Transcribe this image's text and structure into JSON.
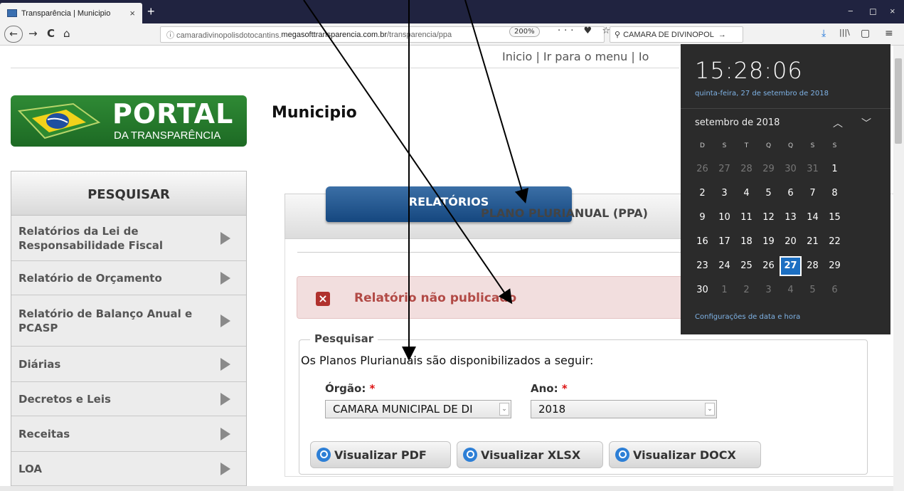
{
  "browser": {
    "tab_title": "Transparência | Municipio",
    "tab_close": "×",
    "new_tab": "+",
    "window_controls": [
      "−",
      "◻",
      "×"
    ],
    "url_prefix": "ⓘ camaradivinopolisdotocantins.",
    "url_host": "megasofttransparencia.com.br",
    "url_path": "/transparencia/ppa",
    "zoom": "200%",
    "url_icons": "··· ♥ ☆",
    "search_text": "CAMARA DE DIVINOPOL",
    "nav": {
      "back": "←",
      "forward": "→",
      "reload": "C",
      "home": "⌂"
    },
    "toolbar_icons": {
      "download": "⤓",
      "library": "|||\\",
      "sidebar": "▢",
      "menu": "≡"
    }
  },
  "page": {
    "top_links": [
      "Inicio",
      "|",
      "Ir para o menu",
      "|",
      "Io"
    ],
    "logo": {
      "title": "PORTAL",
      "subtitle": "DA TRANSPARÊNCIA"
    },
    "title": "Municipio",
    "sidebar": {
      "header": "PESQUISAR",
      "items": [
        {
          "label": "Relatórios da Lei de Responsabilidade Fiscal"
        },
        {
          "label": "Relatório de Orçamento"
        },
        {
          "label": "Relatório de Balanço Anual e PCASP"
        },
        {
          "label": "Diárias"
        },
        {
          "label": "Decretos e Leis"
        },
        {
          "label": "Receitas"
        },
        {
          "label": "LOA"
        }
      ]
    },
    "tabs": {
      "relatorios": "RELATÓRIOS",
      "ppa": "PLANO PLURIANUAL (PPA)"
    },
    "alert": {
      "icon": "×",
      "message": "Relatório não publicado"
    },
    "search_section": {
      "legend": "Pesquisar",
      "intro": "Os Planos Plurianuais são disponibilizados a seguir:",
      "orgao_label": "Órgão:",
      "ano_label": "Ano:",
      "required": "*",
      "orgao_value": "CAMARA MUNICIPAL DE DI",
      "ano_value": "2018",
      "dropdown": "⌄",
      "buttons": [
        "Visualizar PDF",
        "Visualizar XLSX",
        "Visualizar DOCX"
      ]
    }
  },
  "calendar": {
    "time": "15:28:06",
    "date": "quinta-feira, 27 de setembro de 2018",
    "month": "setembro de 2018",
    "prev": "︿",
    "next": "﹀",
    "weekdays": [
      "D",
      "S",
      "T",
      "Q",
      "Q",
      "S",
      "S"
    ],
    "weeks": [
      [
        "26",
        "27",
        "28",
        "29",
        "30",
        "31",
        "1"
      ],
      [
        "2",
        "3",
        "4",
        "5",
        "6",
        "7",
        "8"
      ],
      [
        "9",
        "10",
        "11",
        "12",
        "13",
        "14",
        "15"
      ],
      [
        "16",
        "17",
        "18",
        "19",
        "20",
        "21",
        "22"
      ],
      [
        "23",
        "24",
        "25",
        "26",
        "27",
        "28",
        "29"
      ],
      [
        "30",
        "1",
        "2",
        "3",
        "4",
        "5",
        "6"
      ]
    ],
    "today": "27",
    "settings_link": "Configurações de data e hora"
  },
  "colors": {
    "titlebar": "#202340",
    "relatorios_tab": "#15477f",
    "alert_bg": "#f2dede",
    "alert_text": "#b24a46",
    "calendar_bg": "#2b2b2b",
    "calendar_today": "#1c6fc2",
    "logo_green": "#2f8a35"
  }
}
